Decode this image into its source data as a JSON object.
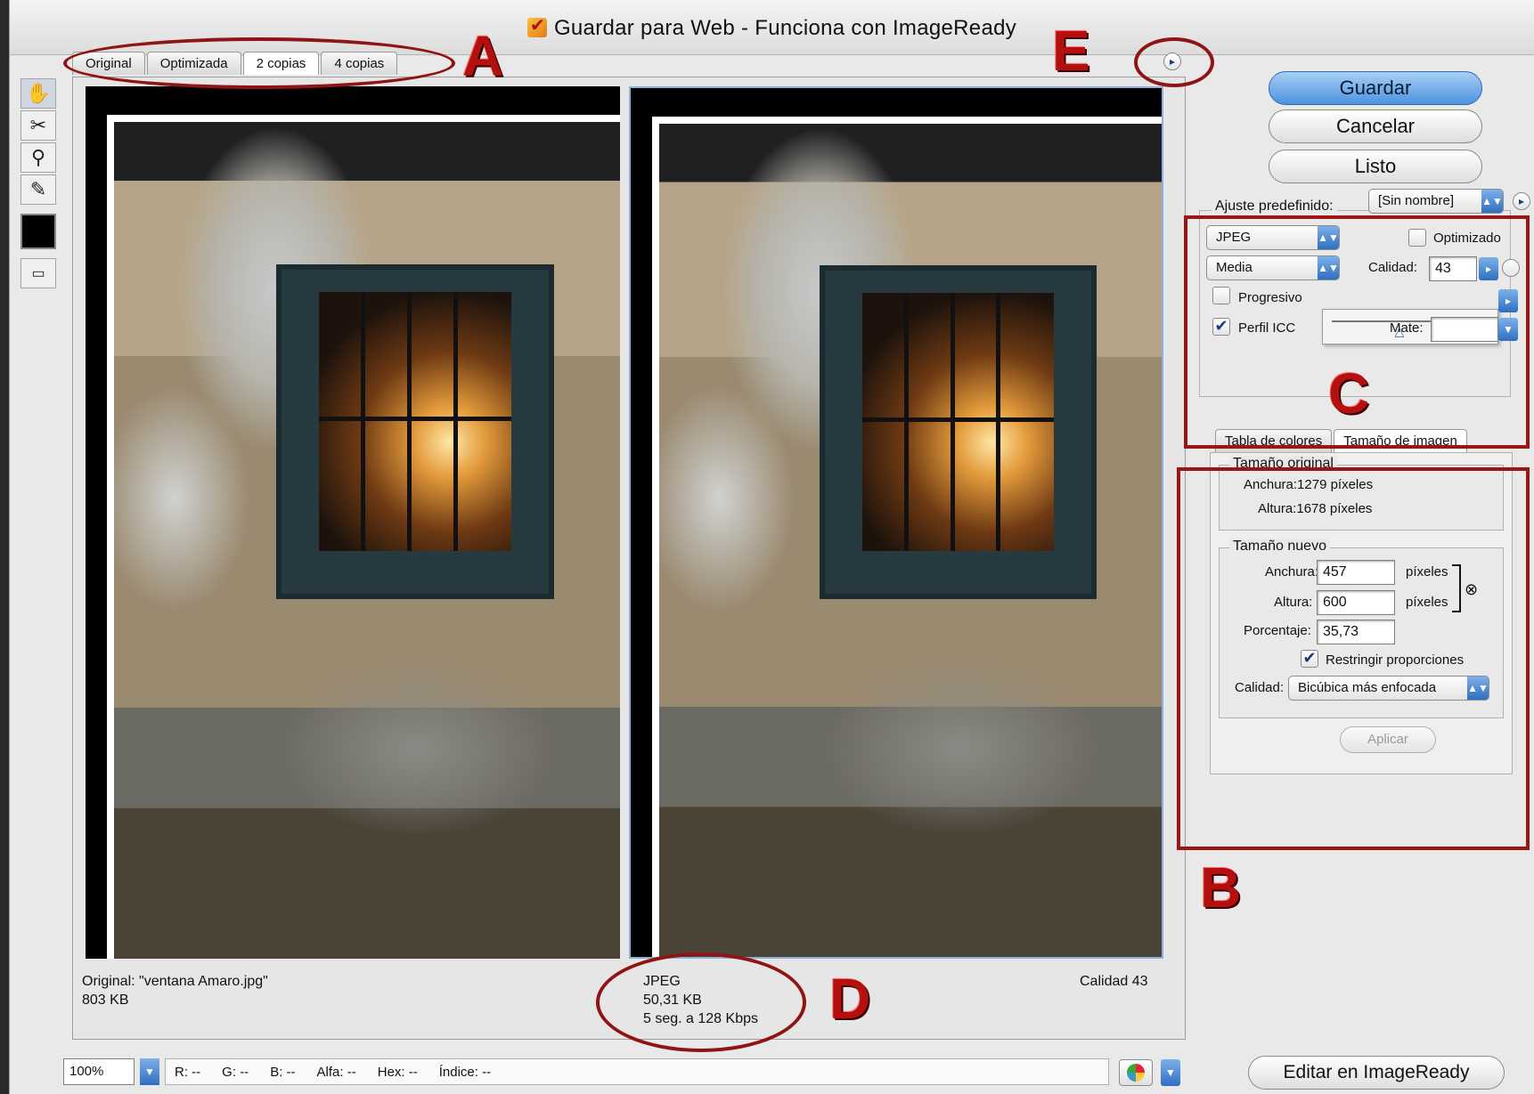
{
  "window": {
    "title": "Guardar para Web - Funciona con ImageReady"
  },
  "view_tabs": [
    {
      "label": "Original",
      "active": false
    },
    {
      "label": "Optimizada",
      "active": false
    },
    {
      "label": "2 copias",
      "active": true
    },
    {
      "label": "4 copias",
      "active": false
    }
  ],
  "tools": [
    "hand-icon",
    "slice-select-icon",
    "zoom-icon",
    "eyedropper-icon"
  ],
  "preview": {
    "left": {
      "line1": "Original: \"ventana Amaro.jpg\"",
      "line2": "803 KB"
    },
    "right": {
      "format": "JPEG",
      "size": "50,31 KB",
      "time": "5 seg. a 128 Kbps",
      "quality": "Calidad 43"
    }
  },
  "actions": {
    "save": "Guardar",
    "cancel": "Cancelar",
    "done": "Listo"
  },
  "settings": {
    "preset_label": "Ajuste predefinido:",
    "preset_value": "[Sin nombre]",
    "format": "JPEG",
    "optimized_label": "Optimizado",
    "quality_preset": "Media",
    "quality_label": "Calidad:",
    "quality_value": "43",
    "progressive_label": "Progresivo",
    "icc_label": "Perfil ICC",
    "icc_checked": true,
    "matte_label": "Mate:",
    "quality_slider": 0.43
  },
  "size_panel": {
    "tabs": [
      {
        "label": "Tabla de colores",
        "active": false
      },
      {
        "label": "Tamaño de imagen",
        "active": true
      }
    ],
    "original_title": "Tamaño original",
    "original_width": "Anchura:1279 píxeles",
    "original_height": "Altura:1678 píxeles",
    "new_title": "Tamaño nuevo",
    "width_label": "Anchura:",
    "width_value": "457",
    "height_label": "Altura:",
    "height_value": "600",
    "unit": "píxeles",
    "percent_label": "Porcentaje:",
    "percent_value": "35,73",
    "constrain_label": "Restringir proporciones",
    "resample_label": "Calidad:",
    "resample_value": "Bicúbica más enfocada",
    "apply": "Aplicar"
  },
  "status": {
    "zoom": "100%",
    "readouts": [
      "R:",
      "--",
      "G:",
      "--",
      "B:",
      "--",
      "Alfa:",
      "--",
      "Hex:",
      "--",
      "Índice:",
      "--"
    ]
  },
  "edit_button": "Editar en ImageReady",
  "annotations": {
    "a": "A",
    "b": "B",
    "c": "C",
    "d": "D",
    "e": "E"
  },
  "colors": {
    "annotation": "#9a1515",
    "primary_button": "#4d93de"
  }
}
